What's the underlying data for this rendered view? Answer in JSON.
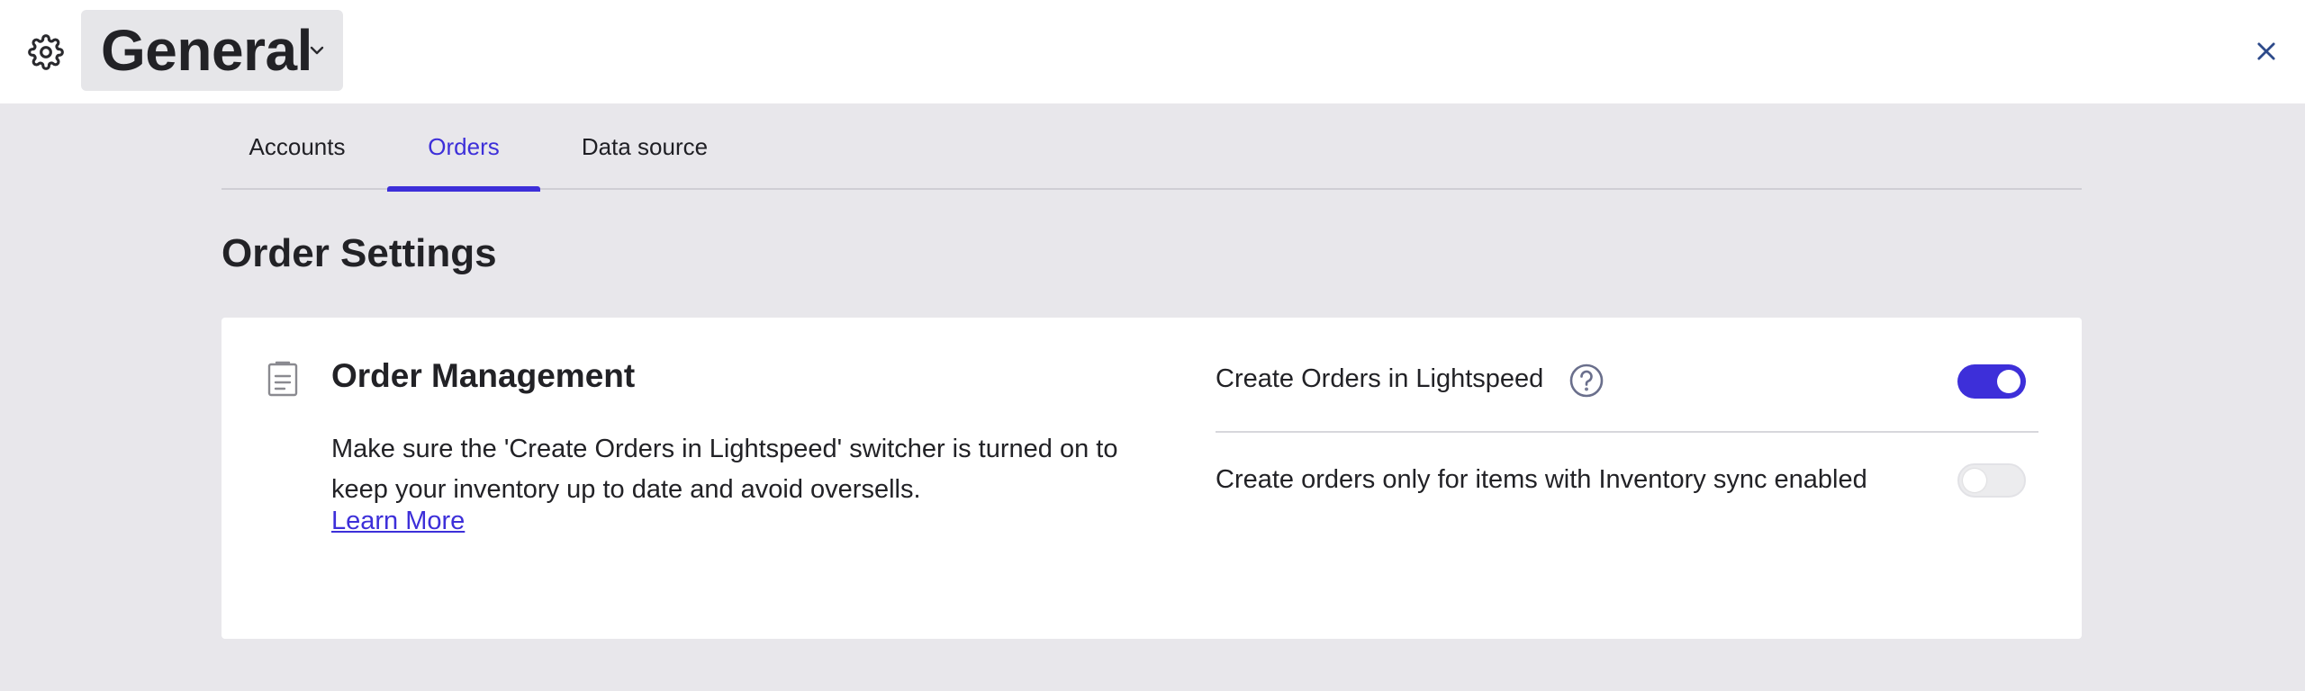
{
  "header": {
    "title": "General"
  },
  "tabs": [
    {
      "label": "Accounts",
      "active": false
    },
    {
      "label": "Orders",
      "active": true
    },
    {
      "label": "Data source",
      "active": false
    }
  ],
  "section": {
    "title": "Order Settings"
  },
  "card": {
    "title": "Order Management",
    "description": "Make sure the 'Create Orders in Lightspeed' switcher is turned on to keep your inventory up to date and avoid oversells.",
    "link": "Learn More",
    "settings": [
      {
        "label": "Create Orders in Lightspeed",
        "enabled": true
      },
      {
        "label": "Create orders only for items with Inventory sync enabled",
        "enabled": false
      }
    ]
  },
  "colors": {
    "accent": "#3d2fd9",
    "background": "#e8e7eb",
    "surface": "#ffffff"
  },
  "icons": {
    "settings": "gear-icon",
    "dropdown": "chevron-down-icon",
    "close": "close-icon",
    "card": "document-icon",
    "help": "help-icon"
  }
}
